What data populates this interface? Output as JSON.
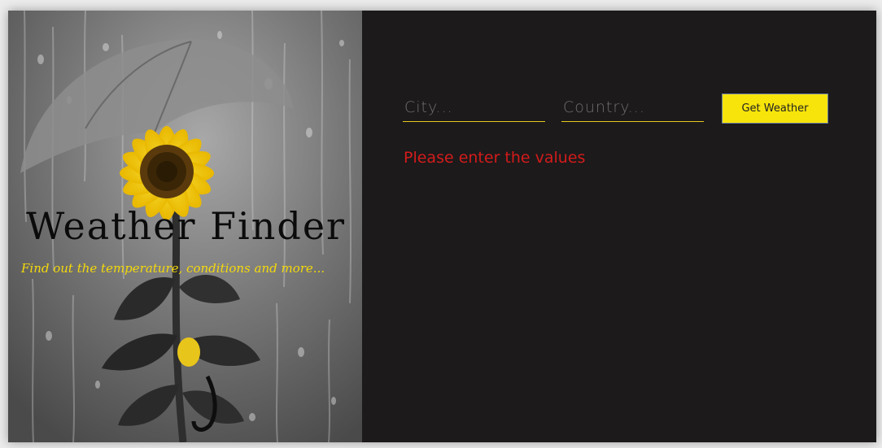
{
  "hero": {
    "title": "Weather Finder",
    "subtitle": "Find out the temperature, conditions and more..."
  },
  "form": {
    "city_placeholder": "City...",
    "city_value": "",
    "country_placeholder": "Country...",
    "country_value": "",
    "submit_label": "Get Weather"
  },
  "status": {
    "error": "Please enter the values"
  },
  "colors": {
    "accent": "#f7e40a",
    "panel_bg": "#1c1a1b",
    "error": "#d41b1b"
  }
}
